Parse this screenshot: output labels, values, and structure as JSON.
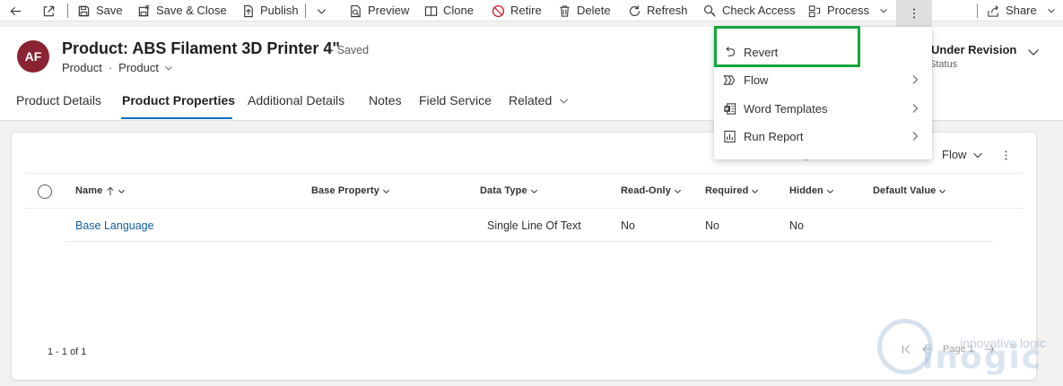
{
  "commandbar": {
    "save": "Save",
    "save_close": "Save & Close",
    "publish": "Publish",
    "preview": "Preview",
    "clone": "Clone",
    "retire": "Retire",
    "delete": "Delete",
    "refresh": "Refresh",
    "check_access": "Check Access",
    "process": "Process",
    "share": "Share"
  },
  "header": {
    "avatar_initials": "AF",
    "title": "Product: ABS Filament 3D Printer 4\"",
    "saved_state": "- Saved",
    "entity": "Product",
    "form": "Product",
    "status_value": "Under Revision",
    "status_label": "Status"
  },
  "tabs": [
    {
      "label": "Product Details"
    },
    {
      "label": "Product Properties"
    },
    {
      "label": "Additional Details"
    },
    {
      "label": "Notes"
    },
    {
      "label": "Field Service"
    },
    {
      "label": "Related"
    }
  ],
  "grid": {
    "toolbar_flow": "Flow",
    "toolbar_partial": "ry",
    "columns": [
      "Name",
      "Base Property",
      "Data Type",
      "Read-Only",
      "Required",
      "Hidden",
      "Default Value"
    ],
    "rows": [
      {
        "name": "Base Language",
        "base_property": "",
        "data_type": "Single Line Of Text",
        "read_only": "No",
        "required": "No",
        "hidden": "No",
        "default_value": ""
      }
    ],
    "record_count": "1 - 1 of 1",
    "page": "Page 1"
  },
  "menu": {
    "items": [
      {
        "label": "Revert"
      },
      {
        "label": "Flow"
      },
      {
        "label": "Word Templates"
      },
      {
        "label": "Run Report"
      }
    ]
  },
  "watermark": {
    "tagline": "innovative logic",
    "brand": "inogic"
  },
  "colors": {
    "accent": "#0f6cbd",
    "avatar": "#8a2432",
    "link": "#115ea3",
    "highlight_box": "#14a73a"
  }
}
